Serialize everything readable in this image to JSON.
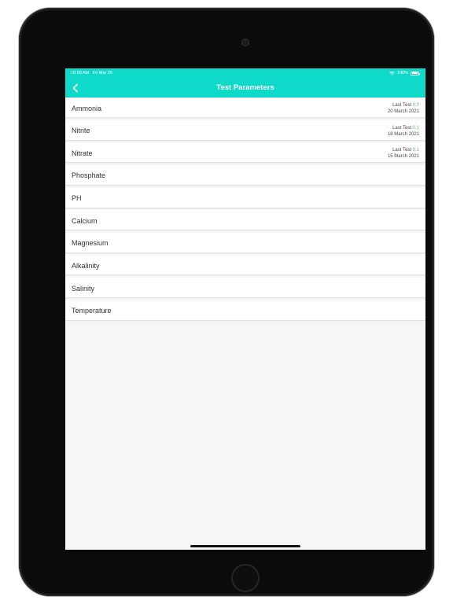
{
  "status_bar": {
    "time": "10:58 AM",
    "date": "Fri Mar 26",
    "battery": "100%",
    "wifi_icon": "wifi-icon",
    "battery_icon": "battery-icon"
  },
  "header": {
    "title": "Test Parameters",
    "back_icon": "chevron-left-icon",
    "color": "#0fdac9"
  },
  "parameters": [
    {
      "label": "Ammonia",
      "last_test_label": "Last Test",
      "last_value": "0.0",
      "last_date": "20 March 2021"
    },
    {
      "label": "Nitrite",
      "last_test_label": "Last Test",
      "last_value": "0.1",
      "last_date": "18 March 2021"
    },
    {
      "label": "Nitrate",
      "last_test_label": "Last Test",
      "last_value": "0.1",
      "last_date": "15 March 2021"
    },
    {
      "label": "Phosphate"
    },
    {
      "label": "PH"
    },
    {
      "label": "Calcium"
    },
    {
      "label": "Magnesium"
    },
    {
      "label": "Alkalinity"
    },
    {
      "label": "Salinity"
    },
    {
      "label": "Temperature"
    }
  ],
  "colors": {
    "accent": "#0fdac9",
    "value_green": "#5ec75e"
  }
}
